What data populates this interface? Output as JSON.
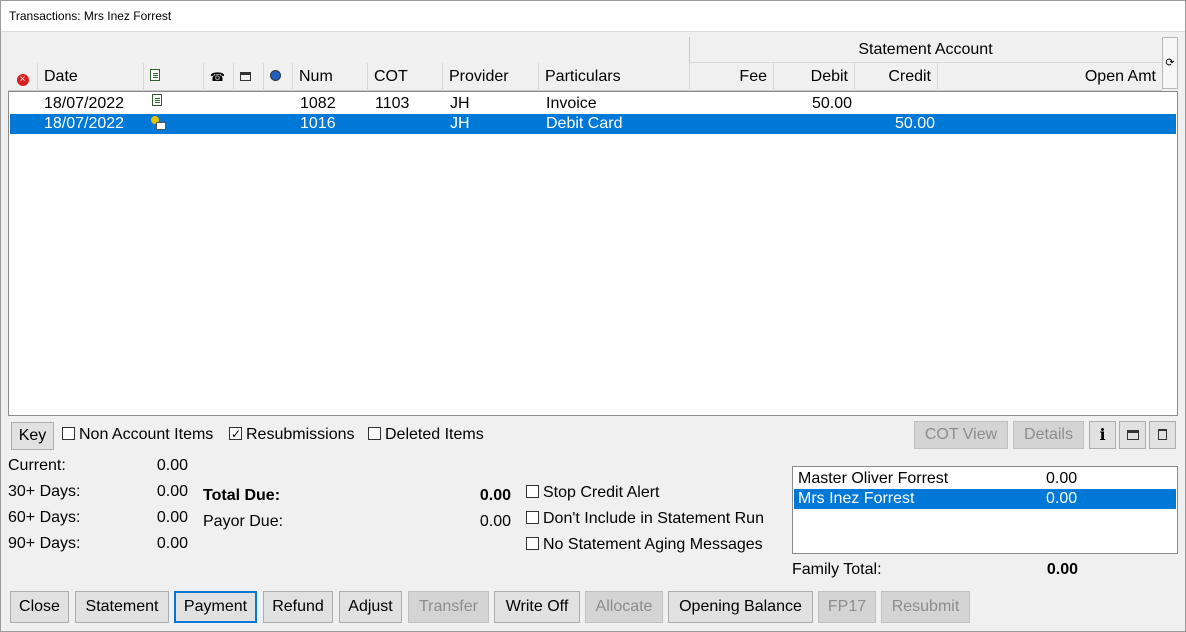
{
  "window": {
    "title": "Transactions: Mrs Inez Forrest"
  },
  "header": {
    "group_label": "Statement Account",
    "columns": {
      "deleted_icon": "deleted-icon",
      "date": "Date",
      "doc_icon": "document-icon",
      "phone_icon": "phone-icon",
      "print_icon": "printer-icon",
      "email_icon": "email-icon",
      "num": "Num",
      "cot": "COT",
      "provider": "Provider",
      "particulars": "Particulars",
      "fee": "Fee",
      "debit": "Debit",
      "credit": "Credit",
      "open_amt": "Open Amt"
    },
    "refresh_symbol": "⟳"
  },
  "transactions": [
    {
      "date": "18/07/2022",
      "icon": "invoice-icon",
      "num": "1082",
      "cot": "1103",
      "provider": "JH",
      "particulars": "Invoice",
      "fee": "",
      "debit": "50.00",
      "credit": "",
      "open_amt": ""
    },
    {
      "date": "18/07/2022",
      "icon": "payment-icon",
      "num": "1016",
      "cot": "",
      "provider": "JH",
      "particulars": "Debit Card",
      "fee": "",
      "debit": "",
      "credit": "50.00",
      "open_amt": ""
    }
  ],
  "options": {
    "key_label": "Key",
    "non_account_items": {
      "label": "Non Account Items",
      "checked": false
    },
    "resubmissions": {
      "label": "Resubmissions",
      "checked": true
    },
    "deleted_items": {
      "label": "Deleted Items",
      "checked": false
    },
    "cot_view_label": "COT View",
    "details_label": "Details",
    "info_symbol": "i",
    "print_symbol": "🖶",
    "trash_symbol": "🗑"
  },
  "aging": {
    "current_label": "Current:",
    "current_value": "0.00",
    "d30_label": "30+ Days:",
    "d30_value": "0.00",
    "d60_label": "60+ Days:",
    "d60_value": "0.00",
    "d90_label": "90+ Days:",
    "d90_value": "0.00"
  },
  "totals": {
    "total_due_label": "Total Due:",
    "total_due_value": "0.00",
    "payor_due_label": "Payor Due:",
    "payor_due_value": "0.00"
  },
  "statement_options": {
    "stop_credit_alert": "Stop Credit Alert",
    "dont_include": "Don't Include in Statement Run",
    "no_aging": "No Statement Aging Messages"
  },
  "family": {
    "members": [
      {
        "name": "Master Oliver Forrest",
        "amount": "0.00"
      },
      {
        "name": "Mrs Inez Forrest",
        "amount": "0.00"
      }
    ],
    "total_label": "Family Total:",
    "total_value": "0.00"
  },
  "buttons": {
    "close": "Close",
    "statement": "Statement",
    "payment": "Payment",
    "refund": "Refund",
    "adjust": "Adjust",
    "transfer": "Transfer",
    "write_off": "Write Off",
    "allocate": "Allocate",
    "opening_balance": "Opening Balance",
    "fp17": "FP17",
    "resubmit": "Resubmit"
  },
  "colors": {
    "selection": "#0078d7",
    "deleted_icon": "#d92020"
  }
}
